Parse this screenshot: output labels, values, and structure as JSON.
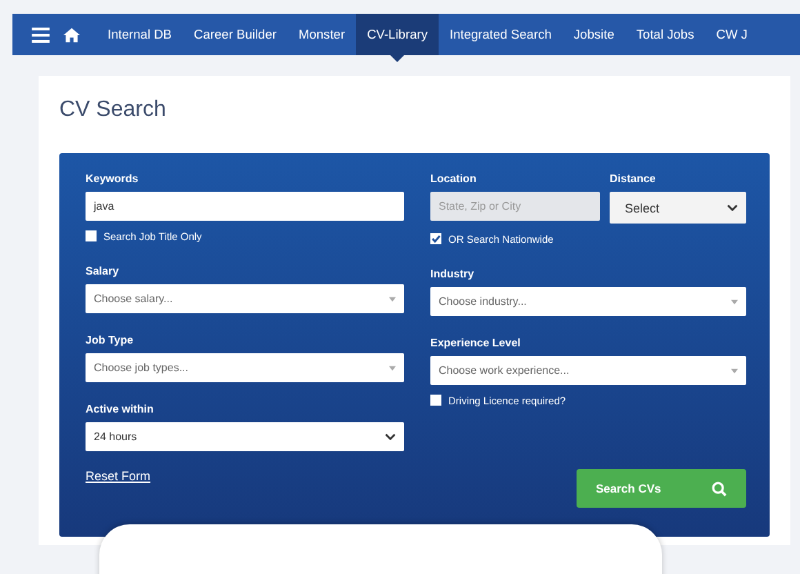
{
  "nav": {
    "items": [
      {
        "label": "Internal DB",
        "selected": false
      },
      {
        "label": "Career Builder",
        "selected": false
      },
      {
        "label": "Monster",
        "selected": false
      },
      {
        "label": "CV-Library",
        "selected": true
      },
      {
        "label": "Integrated Search",
        "selected": false
      },
      {
        "label": "Jobsite",
        "selected": false
      },
      {
        "label": "Total Jobs",
        "selected": false
      },
      {
        "label": "CW J",
        "selected": false
      }
    ]
  },
  "page_title": "CV Search",
  "form": {
    "left": [
      {
        "kind": "text",
        "label": "Keywords",
        "value": "java"
      },
      {
        "kind": "checkbox",
        "label": "Search Job Title Only",
        "checked": false
      },
      {
        "kind": "multiselect",
        "label": "Salary",
        "placeholder": "Choose salary..."
      },
      {
        "kind": "multiselect",
        "label": "Job Type",
        "placeholder": "Choose job types..."
      },
      {
        "kind": "select",
        "label": "Active within",
        "value": "24 hours"
      },
      {
        "kind": "link",
        "label": "Reset Form"
      }
    ],
    "right": [
      {
        "kind": "pair",
        "fields": [
          {
            "kind": "text",
            "label": "Location",
            "placeholder": "State, Zip or City",
            "disabled": true
          },
          {
            "kind": "select",
            "label": "Distance",
            "value": "Select"
          }
        ]
      },
      {
        "kind": "checkbox",
        "label": "OR Search Nationwide",
        "checked": true
      },
      {
        "kind": "multiselect",
        "label": "Industry",
        "placeholder": "Choose industry..."
      },
      {
        "kind": "multiselect",
        "label": "Experience Level",
        "placeholder": "Choose work experience..."
      },
      {
        "kind": "checkbox",
        "label": "Driving Licence required?",
        "checked": false
      },
      {
        "kind": "button",
        "label": "Search CVs"
      }
    ]
  }
}
